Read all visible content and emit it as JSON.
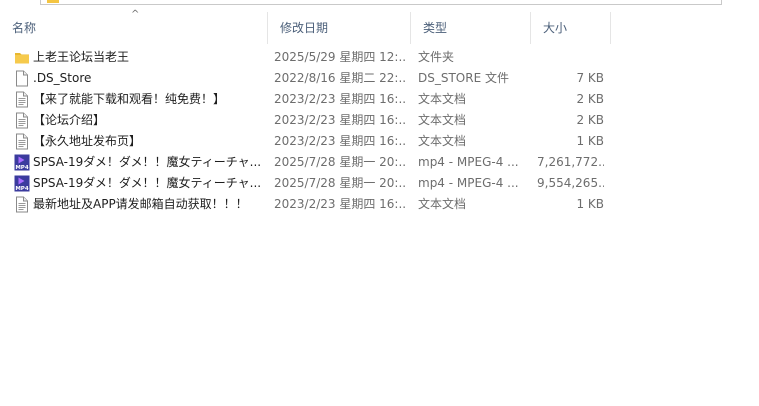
{
  "columns": {
    "name": "名称",
    "date": "修改日期",
    "type": "类型",
    "size": "大小"
  },
  "sort_indicator": "^",
  "files": [
    {
      "icon": "folder-icon",
      "name": "上老王论坛当老王",
      "date": "2025/5/29 星期四 12:...",
      "type": "文件夹",
      "size": ""
    },
    {
      "icon": "blank-file-icon",
      "name": ".DS_Store",
      "date": "2022/8/16 星期二 22:...",
      "type": "DS_STORE 文件",
      "size": "7 KB"
    },
    {
      "icon": "text-file-icon",
      "name": "【来了就能下载和观看！纯免费！】",
      "date": "2023/2/23 星期四 16:...",
      "type": "文本文档",
      "size": "2 KB"
    },
    {
      "icon": "text-file-icon",
      "name": "【论坛介绍】",
      "date": "2023/2/23 星期四 16:...",
      "type": "文本文档",
      "size": "2 KB"
    },
    {
      "icon": "text-file-icon",
      "name": "【永久地址发布页】",
      "date": "2023/2/23 星期四 16:...",
      "type": "文本文档",
      "size": "1 KB"
    },
    {
      "icon": "mp4-file-icon",
      "name": "SPSA-19ダメ！ダメ！！魔女ティーチャ...",
      "date": "2025/7/28 星期一 20:...",
      "type": "mp4 - MPEG-4 ...",
      "size": "7,261,772..."
    },
    {
      "icon": "mp4-file-icon",
      "name": "SPSA-19ダメ！ダメ！！魔女ティーチャ...",
      "date": "2025/7/28 星期一 20:...",
      "type": "mp4 - MPEG-4 ...",
      "size": "9,554,265..."
    },
    {
      "icon": "text-file-icon",
      "name": "最新地址及APP请发邮箱自动获取！！！",
      "date": "2023/2/23 星期四 16:...",
      "type": "文本文档",
      "size": "1 KB"
    }
  ],
  "colors": {
    "header_text": "#4c607a",
    "folder": "#f4c542",
    "mp4_badge": "#3b3b9e",
    "play_accent": "#a86cff"
  }
}
